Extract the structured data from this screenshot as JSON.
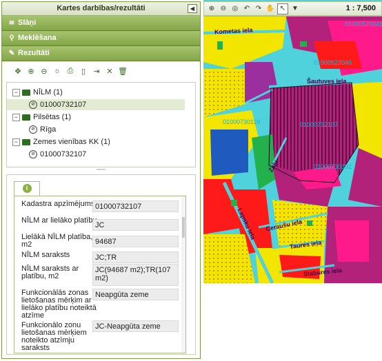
{
  "panel": {
    "title": "Kartes darbības/rezultāti",
    "collapse_icon": "collapse-left-icon"
  },
  "accordion": {
    "layers": "Slāņi",
    "search": "Meklēšana",
    "results": "Rezultāti"
  },
  "toolbar_icons": [
    "expand-all-icon",
    "zoom-in-icon",
    "zoom-out-icon",
    "highlight-icon",
    "print-icon",
    "document-icon",
    "export-icon",
    "clear-icon",
    "delete-icon"
  ],
  "tree": {
    "nodes": [
      {
        "label": "NĪLM (1)",
        "type": "folder"
      },
      {
        "label": "01000732107",
        "type": "leaf"
      },
      {
        "label": "Pilsētas (1)",
        "type": "folder"
      },
      {
        "label": "Rīga",
        "type": "leaf"
      },
      {
        "label": "Zemes vienības KK (1)",
        "type": "folder"
      },
      {
        "label": "01000732107",
        "type": "leaf"
      }
    ]
  },
  "details": {
    "rows": [
      {
        "label": "Kadastra apzīmējums",
        "value": "01000732107"
      },
      {
        "label": "NĪLM ar lielāko platību",
        "value": "JC"
      },
      {
        "label": "Lielākā NĪLM platība, m2",
        "value": "94687"
      },
      {
        "label": "NĪLM saraksts",
        "value": "JC;TR"
      },
      {
        "label": "NĪLM saraksts ar platību, m2",
        "value": "JC(94687 m2);TR(107 m2)"
      },
      {
        "label": "Funkcionālās zonas lietošanas mērķim ar lielāko platību noteiktā atzīme",
        "value": "Neapgūta zeme"
      },
      {
        "label": "Funkcionālo zonu lietošanas mērķiem noteikto atzīmju saraksts",
        "value": "JC-Neapgūta zeme"
      }
    ]
  },
  "map": {
    "scale": "1 : 7,500",
    "tool_icons": [
      "zoom-in-icon",
      "zoom-out-icon",
      "full-extent-icon",
      "back-icon",
      "forward-icon",
      "pan-icon",
      "select-icon",
      "dropdown-icon"
    ],
    "labels": {
      "street_kometas": "Kometas iela",
      "parcel_1": "01000520041",
      "parcel_2": "01000522046",
      "street_sautuves": "Šautuves iela",
      "parcel_3": "01000730116",
      "parcel_4": "01000732107",
      "street_zalu": "Zaļu",
      "parcel_5": "01000730392",
      "street_lapsku": "Lapsku iela",
      "street_cerausu": "Ceraušu iela",
      "street_taures": "Taures iela",
      "street_stabure": "Stabures iela"
    },
    "colors": {
      "zone_mixed": "#b3227a",
      "zone_residential": "#f2e600",
      "zone_public": "#ff1a1a",
      "zone_green": "#22b14c",
      "road": "#4fd2dc",
      "water": "#1f5bbf"
    }
  }
}
